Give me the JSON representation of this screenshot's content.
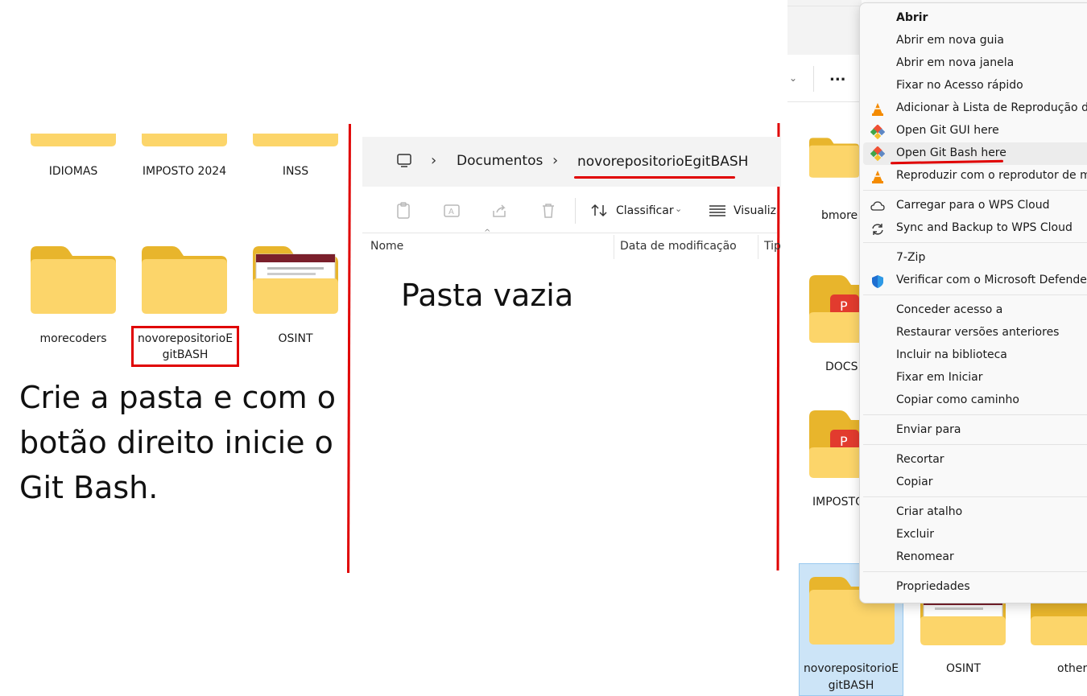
{
  "left_panel": {
    "top_folders": [
      "IDIOMAS",
      "IMPOSTO 2024",
      "INSS"
    ],
    "folders": [
      "morecoders",
      "novorepositorioEgitBASH",
      "OSINT"
    ],
    "highlighted_line1": "novorepositorioE",
    "highlighted_line2": "gitBASH",
    "instruction": "Crie a pasta e com o botão direito inicie o Git Bash."
  },
  "middle_panel": {
    "breadcrumb": [
      "Documentos",
      "novorepositorioEgitBASH"
    ],
    "sort_label": "Classificar",
    "view_label": "Visualiza",
    "columns": [
      "Nome",
      "Data de modificação",
      "Tip"
    ],
    "empty_text": "Pasta vazia"
  },
  "right_panel": {
    "more_label": "...",
    "side_folders": [
      "bmore",
      "DOCS",
      "IMPOSTO"
    ],
    "bottom_folders": [
      "novorepositorioE",
      "gitBASH",
      "OSINT",
      "others"
    ]
  },
  "context_menu": {
    "open": "Abrir",
    "items": [
      "Abrir em nova guia",
      "Abrir em nova janela",
      "Fixar no Acesso rápido",
      "Adicionar à Lista de Reprodução do",
      "Open Git GUI here",
      "Open Git Bash here",
      "Reproduzir com o reprodutor de mí",
      "Carregar para o WPS Cloud",
      "Sync and Backup to WPS Cloud",
      "7-Zip",
      "Verificar com o Microsoft Defender...",
      "Conceder acesso a",
      "Restaurar versões anteriores",
      "Incluir na biblioteca",
      "Fixar em Iniciar",
      "Copiar como caminho",
      "Enviar para",
      "Recortar",
      "Copiar",
      "Criar atalho",
      "Excluir",
      "Renomear",
      "Propriedades"
    ]
  },
  "colors": {
    "annotation_red": "#e00000",
    "folder_yellow": "#fbd34d",
    "selection_blue": "#cce4f7"
  }
}
